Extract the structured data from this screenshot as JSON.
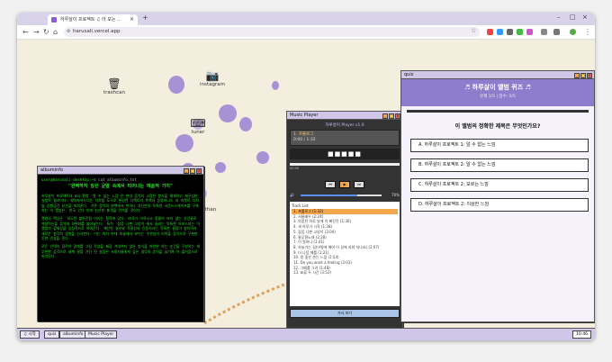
{
  "browser": {
    "tab_title": "하루살이 프로젝트 ♫ 아 모는 ...",
    "url": "harusali.vercel.app"
  },
  "desktop": {
    "icons": [
      {
        "label": "trashcan",
        "glyph": "🗑"
      },
      {
        "label": "instagram",
        "glyph": "📷"
      },
      {
        "label": "tuner",
        "glyph": "⌨"
      },
      {
        "label": "than",
        "glyph": ""
      }
    ]
  },
  "album_info": {
    "title": "albuminfo",
    "prompt_user": "user@harusali-desktop:~$",
    "prompt_cmd": "cat albuminfo.txt",
    "heading": "\"완벽하지 않은 균열 속에서 피어나는 예술적 가치\"",
    "paragraphs": [
      "하루살이 프로젝트의 D비 앨범 '알 수 없는 느낌'은 현대 음악의 고정된 형식을 해체하고 재구성한 실험적 결과이다. 제작자하드너는 디지털 도구로 완성된 디렉토리 폭팩과 음영미니스 지 마켓의 디지털 음향공간 유산을 보여준다. 기존 음악의 완벽에서 벗어나 자신만의 독특한 사운드스케이프를 구축하는 이 앨범은, 한국 인디 씬에 신선한 충격을 안겨줄 것이다.",
      "앨범의 핵심은 '의도된 불완전함'이라는 철학에 있다. 바치가 아큐시고 힘들어 보지 않는 순간들로 엑설럭신을 음악에 보편화를 불어넣는다. 특히 '잡음 나쁜 고양이'에서 들리는 독특한 아포스의는 이 앨범의 정체성을 상징적으로 보여준다. 계산된 실수와 즉흥성의 진동이라는 독특한 결합이 창의력과 새로운 청각적 경험을 선사한다. 이는 마치 현대 미술에서 보이는 우연성의 미학을 음악으로 구현한 듯한 인상을 준다.",
      "모든 선택이 장르의 경계를 그림 작업을 제공 기대하지 않은 방식을 마련한 하는 순간을 구성하는 게 무한한 감각으로 세계 결합 가진 된 걸음은 사용자들에게 깊은 생각의 흔적을 남기며 이 즐거움으로 완성된다."
    ]
  },
  "music_player": {
    "title": "Music Player",
    "version": "하루살이 Player v1.0",
    "now_playing": "1. 프롤로그",
    "time": "0:00 / 1:32",
    "display": "■■■■■",
    "seek_time": "00:00",
    "seek_progress": 0.0,
    "controls": [
      "⏮",
      "▶",
      "⏭"
    ],
    "volume_icon": "🔊",
    "volume_pct": "70%",
    "volume_value": 0.7,
    "track_list_header": "Track List",
    "tracks": [
      "1. 프롤로그 (1:32)",
      "2. 서울배우 (2:24)",
      "3. 아픔된 하루 날에 이 빠진듯 (1:30)",
      "4. 새 하루가 시작 (1:38)",
      "5. 잡음 나쁜 고양이 (3:04)",
      "6. 통무환노래 (2:28)",
      "7. 이 얼마나 (1:41)",
      "8. 하늘가는 길(어떻게 해야 이 길에 지워 지나요) (2:07)",
      "9. 더 나음 때를 (1:21)",
      "10. 용 좋은 손는 느낌 (1:54)",
      "11. Do you want a feeling (3:03)",
      "12. 그때를 그려 (1:48)",
      "13. 표류 두 시간 (3:52)"
    ],
    "hide_button": "가사 보기"
  },
  "quiz": {
    "title": "quiz",
    "heading": "♬ 하루살이 앨범 퀴즈 ♬",
    "status": "문제 1/5 | 점수: 0/5",
    "question": "이 앨범의 정확한 제목은 무엇인가요?",
    "options": [
      {
        "letter": "A.",
        "text": "하루살이 프로젝트 1: 알 수 없는 느낌"
      },
      {
        "letter": "B.",
        "text": "하루살이 프로젝트 2: 알 수 없는 느낌"
      },
      {
        "letter": "C.",
        "text": "하루살이 프로젝트 2: 모르는 느낌"
      },
      {
        "letter": "D.",
        "text": "하루살이 프로젝트 2: 이상한 느낌"
      }
    ]
  },
  "taskbar": {
    "start": "♫ 시작",
    "items": [
      "quiz",
      "albuminfo",
      "Music Player"
    ],
    "clock": "10:46"
  },
  "colors": {
    "accent": "#8e7ccd",
    "desktop_bg": "#f4eedf",
    "terminal_text": "#2be02b",
    "selected_track": "#f4a64c"
  }
}
